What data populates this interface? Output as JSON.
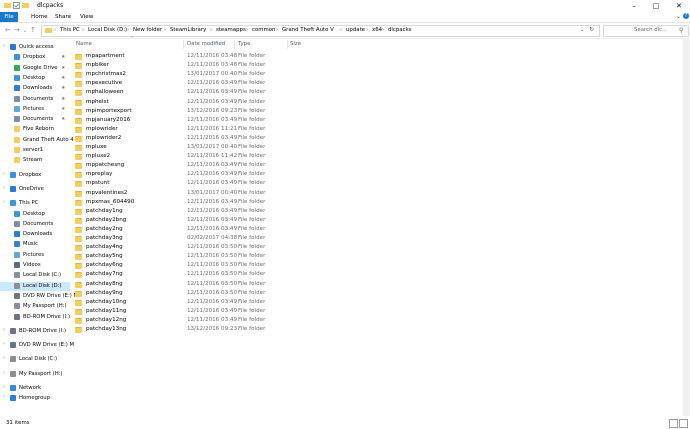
{
  "window": {
    "title": "dlcpacks",
    "colors": {
      "accent": "#1979ca",
      "folder": "#f3cf61",
      "selected": "#cce8ff"
    }
  },
  "ribbon": {
    "tabs": [
      "File",
      "Home",
      "Share",
      "View"
    ]
  },
  "address": {
    "crumbs": [
      "This PC",
      "Local Disk (D:)",
      "New folder",
      "SteamLibrary",
      "steamapps",
      "common",
      "Grand Theft Auto V",
      "update",
      "x64",
      "dlcpacks"
    ],
    "search_placeholder": "Search dlc..."
  },
  "nav": [
    {
      "label": "Quick access",
      "icon": "star-icon",
      "level": 0
    },
    {
      "label": "Dropbox",
      "icon": "dropbox-icon",
      "level": 1,
      "pinned": true
    },
    {
      "label": "Google Drive",
      "icon": "google-drive-icon",
      "level": 1,
      "pinned": true
    },
    {
      "label": "Desktop",
      "icon": "desktop-icon",
      "level": 1,
      "pinned": true
    },
    {
      "label": "Downloads",
      "icon": "download-icon",
      "level": 1,
      "pinned": true
    },
    {
      "label": "Documents",
      "icon": "documents-icon",
      "level": 1,
      "pinned": true
    },
    {
      "label": "Pictures",
      "icon": "pictures-icon",
      "level": 1,
      "pinned": true
    },
    {
      "label": "Documents",
      "icon": "documents-icon",
      "level": 1,
      "pinned": true
    },
    {
      "label": "Five Reborn",
      "icon": "folder-icon",
      "level": 1
    },
    {
      "label": "Grand Theft Auto 4",
      "icon": "folder-icon",
      "level": 1
    },
    {
      "label": "server1",
      "icon": "folder-icon",
      "level": 1
    },
    {
      "label": "Stream",
      "icon": "folder-icon",
      "level": 1
    },
    {
      "label": "",
      "icon": "",
      "level": -1
    },
    {
      "label": "Dropbox",
      "icon": "dropbox-icon",
      "level": 0
    },
    {
      "label": "",
      "icon": "",
      "level": -1
    },
    {
      "label": "OneDrive",
      "icon": "onedrive-icon",
      "level": 0
    },
    {
      "label": "",
      "icon": "",
      "level": -1
    },
    {
      "label": "This PC",
      "icon": "computer-icon",
      "level": 0
    },
    {
      "label": "Desktop",
      "icon": "desktop-icon",
      "level": 1
    },
    {
      "label": "Documents",
      "icon": "documents-icon",
      "level": 1
    },
    {
      "label": "Downloads",
      "icon": "download-icon",
      "level": 1
    },
    {
      "label": "Music",
      "icon": "music-icon",
      "level": 1
    },
    {
      "label": "Pictures",
      "icon": "pictures-icon",
      "level": 1
    },
    {
      "label": "Videos",
      "icon": "videos-icon",
      "level": 1
    },
    {
      "label": "Local Disk (C:)",
      "icon": "drive-icon",
      "level": 1
    },
    {
      "label": "Local Disk (D:)",
      "icon": "drive-icon",
      "level": 1,
      "selected": true
    },
    {
      "label": "DVD RW Drive (E:) M",
      "icon": "dvd-icon",
      "level": 1
    },
    {
      "label": "My Passport (H:)",
      "icon": "drive-icon",
      "level": 1
    },
    {
      "label": "BD-ROM Drive (I:)",
      "icon": "dvd-icon",
      "level": 1
    },
    {
      "label": "",
      "icon": "",
      "level": -1
    },
    {
      "label": "BD-ROM Drive (I:)",
      "icon": "dvd-icon",
      "level": 0
    },
    {
      "label": "",
      "icon": "",
      "level": -1
    },
    {
      "label": "DVD RW Drive (E:) M",
      "icon": "dvd-icon",
      "level": 0
    },
    {
      "label": "",
      "icon": "",
      "level": -1
    },
    {
      "label": "Local Disk (C:)",
      "icon": "drive-icon",
      "level": 0
    },
    {
      "label": "",
      "icon": "",
      "level": -1
    },
    {
      "label": "My Passport (H:)",
      "icon": "drive-icon",
      "level": 0
    },
    {
      "label": "",
      "icon": "",
      "level": -1
    },
    {
      "label": "Network",
      "icon": "network-icon",
      "level": 0
    },
    {
      "label": "Homegroup",
      "icon": "homegroup-icon",
      "level": 0
    }
  ],
  "columns": [
    "Name",
    "Date modified",
    "Type",
    "Size"
  ],
  "files": [
    {
      "name": "mpapartment",
      "date": "12/11/2016 03:48",
      "type": "File folder"
    },
    {
      "name": "mpbiker",
      "date": "12/11/2016 03:48",
      "type": "File folder"
    },
    {
      "name": "mpchristmas2",
      "date": "13/01/2017 00:40",
      "type": "File folder"
    },
    {
      "name": "mpexecutive",
      "date": "12/11/2016 03:49",
      "type": "File folder"
    },
    {
      "name": "mphalloween",
      "date": "12/11/2016 03:49",
      "type": "File folder"
    },
    {
      "name": "mpheist",
      "date": "12/11/2016 03:49",
      "type": "File folder"
    },
    {
      "name": "mpimportexport",
      "date": "13/12/2016 09:23",
      "type": "File folder"
    },
    {
      "name": "mpjanuary2016",
      "date": "12/11/2016 03:49",
      "type": "File folder"
    },
    {
      "name": "mplowrider",
      "date": "12/11/2016 11:21",
      "type": "File folder"
    },
    {
      "name": "mplowrider2",
      "date": "12/11/2016 03:49",
      "type": "File folder"
    },
    {
      "name": "mpluxe",
      "date": "13/01/2017 00:40",
      "type": "File folder"
    },
    {
      "name": "mpluxe2",
      "date": "12/11/2016 11:42",
      "type": "File folder"
    },
    {
      "name": "mppatchesng",
      "date": "12/11/2016 03:49",
      "type": "File folder"
    },
    {
      "name": "mpreplay",
      "date": "12/11/2016 03:49",
      "type": "File folder"
    },
    {
      "name": "mpstunt",
      "date": "12/11/2016 03:49",
      "type": "File folder"
    },
    {
      "name": "mpvalentines2",
      "date": "13/01/2017 00:40",
      "type": "File folder"
    },
    {
      "name": "mpxmas_604490",
      "date": "12/11/2016 03:49",
      "type": "File folder"
    },
    {
      "name": "patchday1ng",
      "date": "12/11/2016 03:49",
      "type": "File folder"
    },
    {
      "name": "patchday2bng",
      "date": "12/11/2016 03:49",
      "type": "File folder"
    },
    {
      "name": "patchday2ng",
      "date": "12/11/2016 03:49",
      "type": "File folder"
    },
    {
      "name": "patchday3ng",
      "date": "02/02/2017 04:38",
      "type": "File folder"
    },
    {
      "name": "patchday4ng",
      "date": "12/11/2016 03:50",
      "type": "File folder"
    },
    {
      "name": "patchday5ng",
      "date": "12/11/2016 03:50",
      "type": "File folder"
    },
    {
      "name": "patchday6ng",
      "date": "12/11/2016 03:50",
      "type": "File folder"
    },
    {
      "name": "patchday7ng",
      "date": "12/11/2016 03:50",
      "type": "File folder"
    },
    {
      "name": "patchday8ng",
      "date": "12/11/2016 03:50",
      "type": "File folder"
    },
    {
      "name": "patchday9ng",
      "date": "12/11/2016 03:50",
      "type": "File folder"
    },
    {
      "name": "patchday10ng",
      "date": "12/11/2016 03:49",
      "type": "File folder"
    },
    {
      "name": "patchday11ng",
      "date": "12/11/2016 03:49",
      "type": "File folder"
    },
    {
      "name": "patchday12ng",
      "date": "12/11/2016 03:49",
      "type": "File folder"
    },
    {
      "name": "patchday13ng",
      "date": "13/12/2016 09:23",
      "type": "File folder"
    }
  ],
  "status": {
    "count_text": "31 items"
  }
}
